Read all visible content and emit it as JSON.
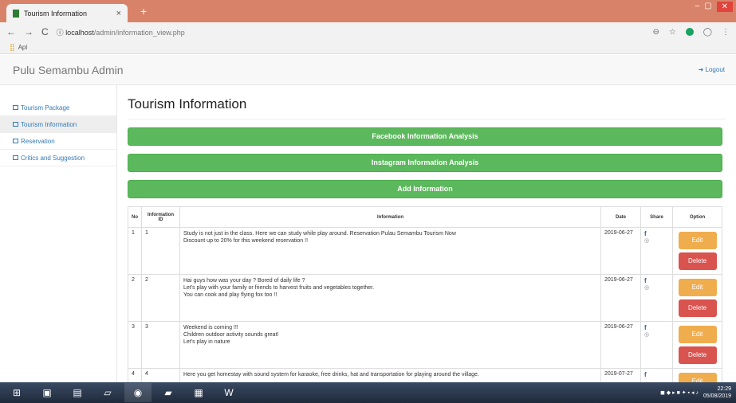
{
  "browser": {
    "tab_title": "Tourism Information",
    "tab_close": "×",
    "new_tab": "+",
    "url_host": "localhost",
    "url_path": "/admin/information_view.php",
    "bookmark_label": "Apl"
  },
  "navbar": {
    "brand": "Pulu Semambu Admin",
    "logout": "Logout"
  },
  "sidebar": {
    "items": [
      {
        "label": "Tourism Package"
      },
      {
        "label": "Tourism Information"
      },
      {
        "label": "Reservation"
      },
      {
        "label": "Critics and Suggestion"
      }
    ]
  },
  "main": {
    "title": "Tourism Information",
    "buttons": {
      "facebook": "Facebook Information Analysis",
      "instagram": "Instagram Information Analysis",
      "add": "Add Information"
    },
    "table": {
      "headers": [
        "No",
        "Information ID",
        "Information",
        "Date",
        "Share",
        "Option"
      ],
      "rows": [
        {
          "no": "1",
          "id": "1",
          "info": [
            "Study is not just in the class. Here we can study while play around. Reservation Pulau Semambu Tourism Now",
            "Discount up to 20% for this weekend reservation !!"
          ],
          "date": "2019-06-27"
        },
        {
          "no": "2",
          "id": "2",
          "info": [
            "Hai guys how was your day ? Bored of daily life ?",
            "Let's play with your family or friends to harvest fruits and vegetables together.",
            "You can cook and play flying fox too !!"
          ],
          "date": "2019-06-27"
        },
        {
          "no": "3",
          "id": "3",
          "info": [
            "Weekend is coming !!!",
            "Children outdoor activity sounds great!",
            "Let's play in nature"
          ],
          "date": "2019-06-27"
        },
        {
          "no": "4",
          "id": "4",
          "info": [
            "Here you get homestay with sound system for karaoke, free drinks, hat and transportation for playing around the village."
          ],
          "date": "2019-07-27"
        }
      ],
      "edit_label": "Edit",
      "delete_label": "Delete",
      "share_fb": "f"
    }
  },
  "taskbar": {
    "time": "22:29",
    "date": "05/08/2019"
  }
}
